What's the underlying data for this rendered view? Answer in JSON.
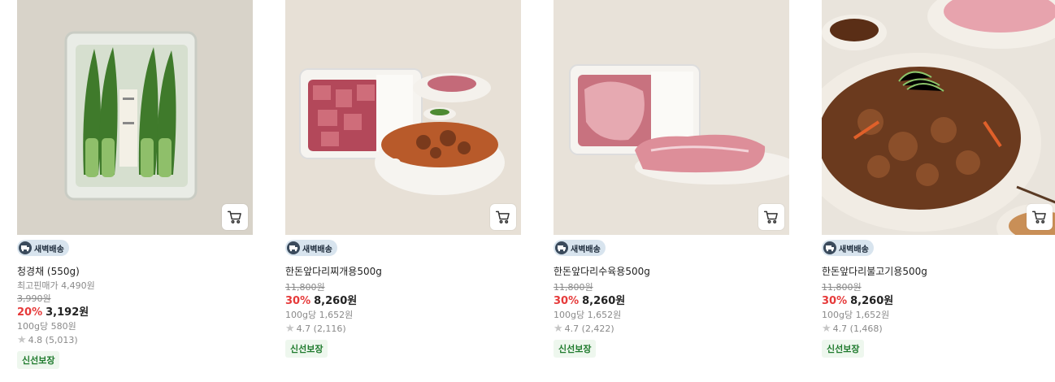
{
  "products": [
    {
      "badge": "새벽배송",
      "name": "청경채 (550g)",
      "highest_price": "최고핀매가 4,490원",
      "original_price": "3,990원",
      "discount": "20%",
      "price": "3,192원",
      "unit_price": "100g당 580원",
      "rating": "4.8 (5,013)",
      "tag": "신선보장",
      "image": "bok-choy-package"
    },
    {
      "badge": "새벽배송",
      "name": "한돈앞다리찌개용500g",
      "original_price": "11,800원",
      "discount": "30%",
      "price": "8,260원",
      "unit_price": "100g당 1,652원",
      "rating": "4.7 (2,116)",
      "tag": "신선보장",
      "image": "pork-stew-cut-with-kimchi-stew"
    },
    {
      "badge": "새벽배송",
      "name": "한돈앞다리수육용500g",
      "original_price": "11,800원",
      "discount": "30%",
      "price": "8,260원",
      "unit_price": "100g당 1,652원",
      "rating": "4.7 (2,422)",
      "tag": "신선보장",
      "image": "pork-boiling-cut"
    },
    {
      "badge": "새벽배송",
      "name": "한돈앞다리불고기용500g",
      "original_price": "11,800원",
      "discount": "30%",
      "price": "8,260원",
      "unit_price": "100g당 1,652원",
      "rating": "4.7 (1,468)",
      "tag": "신선보장",
      "image": "pork-bulgogi-plate"
    }
  ],
  "colors": {
    "discount": "#e63a3a",
    "fresh_tag_bg": "#eef7ee",
    "fresh_tag_text": "#1e7a2c",
    "badge_bg": "#d8e4ee"
  },
  "icons": {
    "cart": "cart-icon",
    "delivery": "truck-icon",
    "rating": "star-icon"
  }
}
